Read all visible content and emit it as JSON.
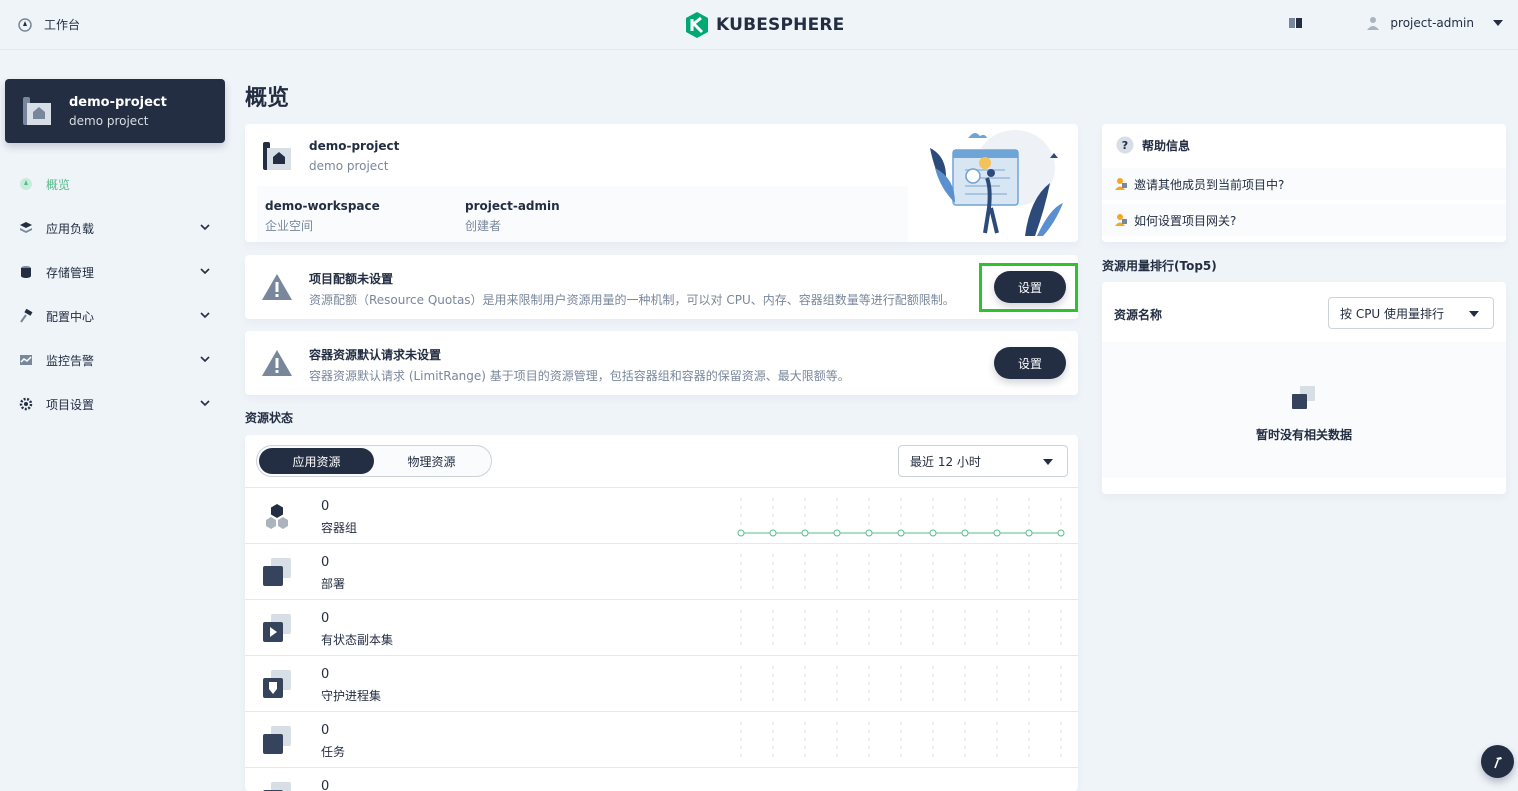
{
  "topbar": {
    "workbench_label": "工作台",
    "logo_text": "KUBESPHERE",
    "username": "project-admin"
  },
  "sidebar": {
    "project_name": "demo-project",
    "project_alias": "demo project",
    "items": [
      {
        "label": "概览",
        "icon": "dashboard-icon",
        "active": true
      },
      {
        "label": "应用负载",
        "icon": "appcenter-icon"
      },
      {
        "label": "存储管理",
        "icon": "database-icon"
      },
      {
        "label": "配置中心",
        "icon": "hammer-icon"
      },
      {
        "label": "监控告警",
        "icon": "monitor-icon"
      },
      {
        "label": "项目设置",
        "icon": "gear-icon"
      }
    ]
  },
  "main": {
    "title": "概览",
    "info": {
      "name": "demo-project",
      "alias": "demo project",
      "workspace_value": "demo-workspace",
      "workspace_label": "企业空间",
      "creator_value": "project-admin",
      "creator_label": "创建者"
    },
    "quota_warning": {
      "title": "项目配额未设置",
      "desc": "资源配额（Resource Quotas）是用来限制用户资源用量的一种机制，可以对 CPU、内存、容器组数量等进行配额限制。",
      "button": "设置"
    },
    "limit_warning": {
      "title": "容器资源默认请求未设置",
      "desc": "容器资源默认请求 (LimitRange) 基于项目的资源管理，包括容器组和容器的保留资源、最大限额等。",
      "button": "设置"
    },
    "resource_status": {
      "section_title": "资源状态",
      "tabs": [
        "应用资源",
        "物理资源"
      ],
      "time_range": "最近 12 小时",
      "rows": [
        {
          "count": "0",
          "label": "容器组",
          "icon": "pods-icon"
        },
        {
          "count": "0",
          "label": "部署",
          "icon": "deployment-icon"
        },
        {
          "count": "0",
          "label": "有状态副本集",
          "icon": "statefulset-icon"
        },
        {
          "count": "0",
          "label": "守护进程集",
          "icon": "daemonset-icon"
        },
        {
          "count": "0",
          "label": "任务",
          "icon": "job-icon"
        },
        {
          "count": "0",
          "label": "",
          "icon": "cronjob-icon"
        }
      ]
    }
  },
  "help": {
    "title": "帮助信息",
    "items": [
      "邀请其他成员到当前项目中?",
      "如何设置项目网关?"
    ]
  },
  "ranking": {
    "section_title": "资源用量排行(Top5)",
    "name_label": "资源名称",
    "sort_select": "按 CPU 使用量排行",
    "empty_text": "暂时没有相关数据"
  },
  "colors": {
    "accent": "#55bc8a",
    "dark": "#242e42",
    "highlight": "#2fc22f"
  }
}
